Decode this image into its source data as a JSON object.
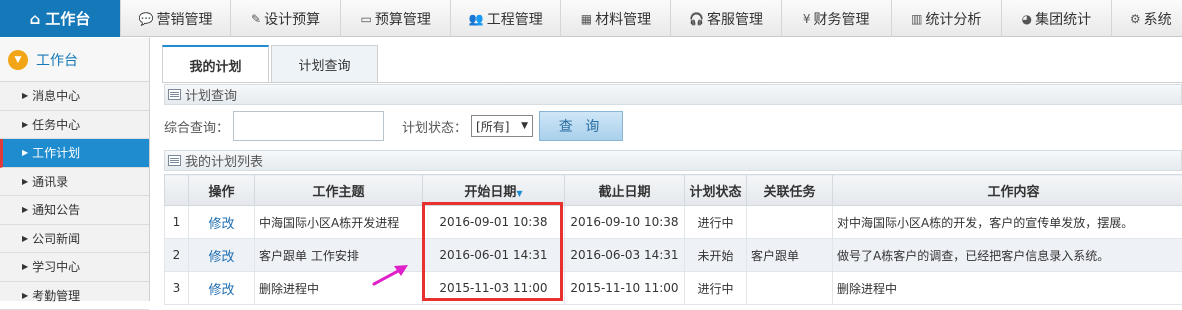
{
  "topnav": {
    "home": "工作台",
    "items": [
      {
        "label": "营销管理",
        "icon": "chat-icon",
        "glyph": "💬"
      },
      {
        "label": "设计预算",
        "icon": "edit-icon",
        "glyph": "✎"
      },
      {
        "label": "预算管理",
        "icon": "monitor-icon",
        "glyph": "▭"
      },
      {
        "label": "工程管理",
        "icon": "users-icon",
        "glyph": "👥"
      },
      {
        "label": "材料管理",
        "icon": "grid-icon",
        "glyph": "▦"
      },
      {
        "label": "客服管理",
        "icon": "headset-icon",
        "glyph": "🎧"
      },
      {
        "label": "财务管理",
        "icon": "yen-icon",
        "glyph": "¥"
      },
      {
        "label": "统计分析",
        "icon": "chart-icon",
        "glyph": "▥"
      },
      {
        "label": "集团统计",
        "icon": "pie-icon",
        "glyph": "◕"
      },
      {
        "label": "系统",
        "icon": "gear-icon",
        "glyph": "⚙"
      }
    ]
  },
  "sidebar": {
    "title": "工作台",
    "items": [
      {
        "label": "消息中心",
        "active": false
      },
      {
        "label": "任务中心",
        "active": false
      },
      {
        "label": "工作计划",
        "active": true
      },
      {
        "label": "通讯录",
        "active": false
      },
      {
        "label": "通知公告",
        "active": false
      },
      {
        "label": "公司新闻",
        "active": false
      },
      {
        "label": "学习中心",
        "active": false
      },
      {
        "label": "考勤管理",
        "active": false
      }
    ]
  },
  "tabs": [
    {
      "label": "我的计划",
      "active": true
    },
    {
      "label": "计划查询",
      "active": false
    }
  ],
  "query_section": {
    "title": "计划查询",
    "keyword_label": "综合查询：",
    "keyword_value": "",
    "status_label": "计划状态：",
    "status_value": "[所有]",
    "query_button": "查 询"
  },
  "list_section": {
    "title": "我的计划列表",
    "columns": [
      "",
      "操作",
      "工作主题",
      "开始日期",
      "截止日期",
      "计划状态",
      "关联任务",
      "工作内容"
    ],
    "rows": [
      {
        "no": "1",
        "action": "修改",
        "subject": "中海国际小区A栋开发进程",
        "start": "2016-09-01 10:38",
        "end": "2016-09-10 10:38",
        "status": "进行中",
        "task": "",
        "content": "对中海国际小区A栋的开发，客户的宣传单发放，摆展。"
      },
      {
        "no": "2",
        "action": "修改",
        "subject": "客户跟单 工作安排",
        "start": "2016-06-01 14:31",
        "end": "2016-06-03 14:31",
        "status": "未开始",
        "task": "客户跟单",
        "content": "做号了A栋客户的调查，已经把客户信息录入系统。"
      },
      {
        "no": "3",
        "action": "修改",
        "subject": "删除进程中",
        "start": "2015-11-03 11:00",
        "end": "2015-11-10 11:00",
        "status": "进行中",
        "task": "",
        "content": "删除进程中"
      }
    ]
  },
  "colors": {
    "accent": "#1578b8",
    "active_sidebar": "#1f8ccf",
    "highlight_box": "#e8302f",
    "arrow": "#e020c8"
  }
}
